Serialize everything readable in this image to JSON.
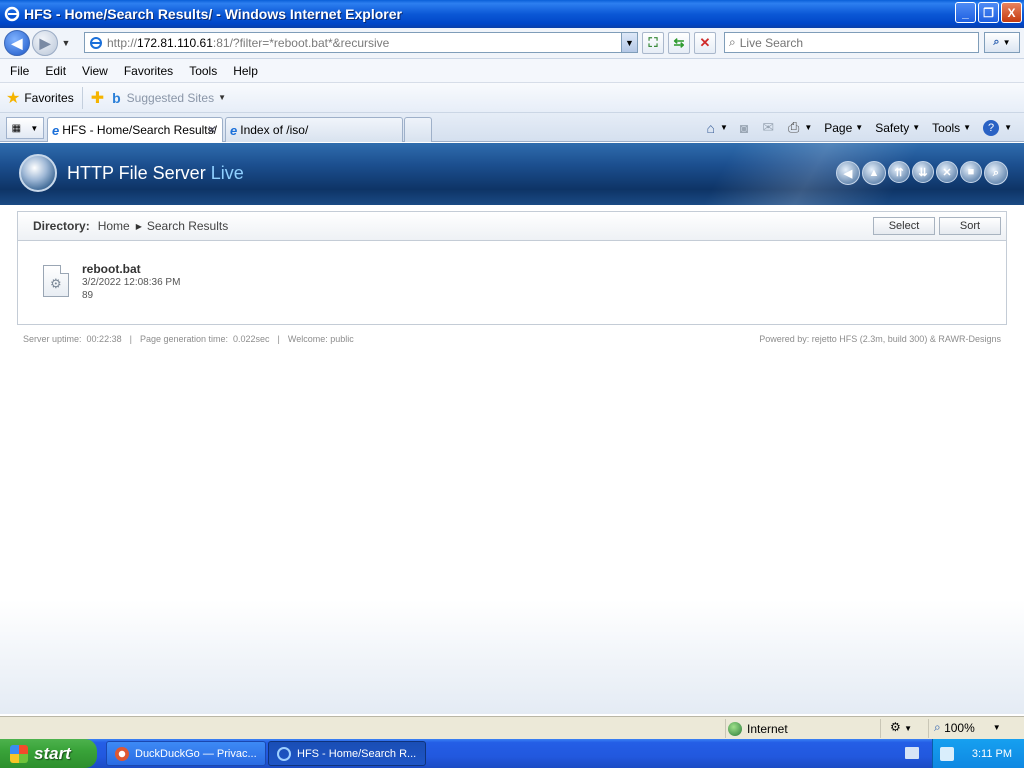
{
  "window": {
    "title": "HFS - Home/Search Results/ - Windows Internet Explorer",
    "buttons": [
      "_",
      "❐",
      "X"
    ]
  },
  "address": {
    "url_prefix": "http://",
    "url_host": "172.81.110.61",
    "url_rest": ":81/?filter=*reboot.bat*&recursive",
    "search_placeholder": "Live Search"
  },
  "menu": [
    "File",
    "Edit",
    "View",
    "Favorites",
    "Tools",
    "Help"
  ],
  "favorites": {
    "label": "Favorites",
    "suggested": "Suggested Sites"
  },
  "tabs": [
    {
      "label": "HFS - Home/Search Results/",
      "active": true
    },
    {
      "label": "Index of /iso/",
      "active": false
    }
  ],
  "command_bar": {
    "page": "Page",
    "safety": "Safety",
    "tools": "Tools"
  },
  "hfs": {
    "title_main": "HTTP File Server",
    "title_live": "Live",
    "directory_label": "Directory:",
    "breadcrumb_home": "Home",
    "breadcrumb_current": "Search Results",
    "select_btn": "Select",
    "sort_btn": "Sort",
    "files": [
      {
        "name": "reboot.bat",
        "date": "3/2/2022 12:08:36 PM",
        "size": "89"
      }
    ],
    "footer": {
      "uptime_label": "Server uptime:",
      "uptime": "00:22:38",
      "gentime_label": "Page generation time:",
      "gentime": "0.022sec",
      "welcome_label": "Welcome:",
      "welcome": "public",
      "powered": "Powered by: rejetto HFS (2.3m, build 300) & RAWR-Designs"
    }
  },
  "status": {
    "zone": "Internet",
    "zoom": "100%"
  },
  "taskbar": {
    "start": "start",
    "items": [
      "DuckDuckGo — Privac...",
      "HFS - Home/Search R..."
    ],
    "clock": "3:11 PM"
  },
  "colors": {
    "titlebar": "#0b58d6",
    "hfs_banner": "#1c4f8f",
    "live_accent": "#8fd0ff"
  }
}
